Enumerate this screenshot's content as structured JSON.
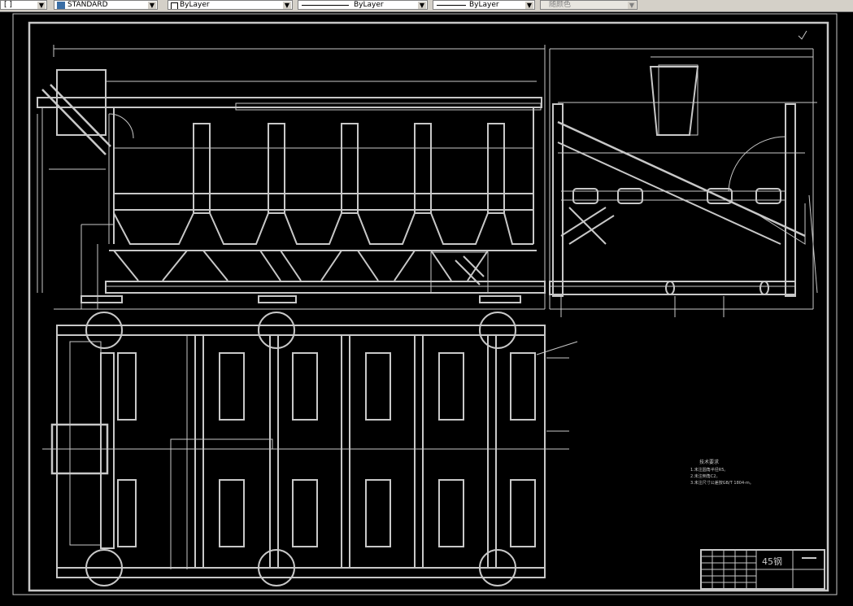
{
  "toolbar": {
    "left_text": "[ ]",
    "text_style": "STANDARD",
    "layer": "ByLayer",
    "linetype": "ByLayer",
    "lineweight": "ByLayer",
    "color": "随颜色"
  },
  "drawing": {
    "title_block_material": "45钢",
    "tech_req_title": "技术要求",
    "tech_req_items": [
      "1.未注圆角半径R5。",
      "2.未注倒角C2。",
      "3.未注尺寸公差按GB/T 1804-m。"
    ]
  },
  "colors": {
    "background": "#000000",
    "line": "#c8c8c8",
    "toolbar": "#d4d0c8"
  }
}
